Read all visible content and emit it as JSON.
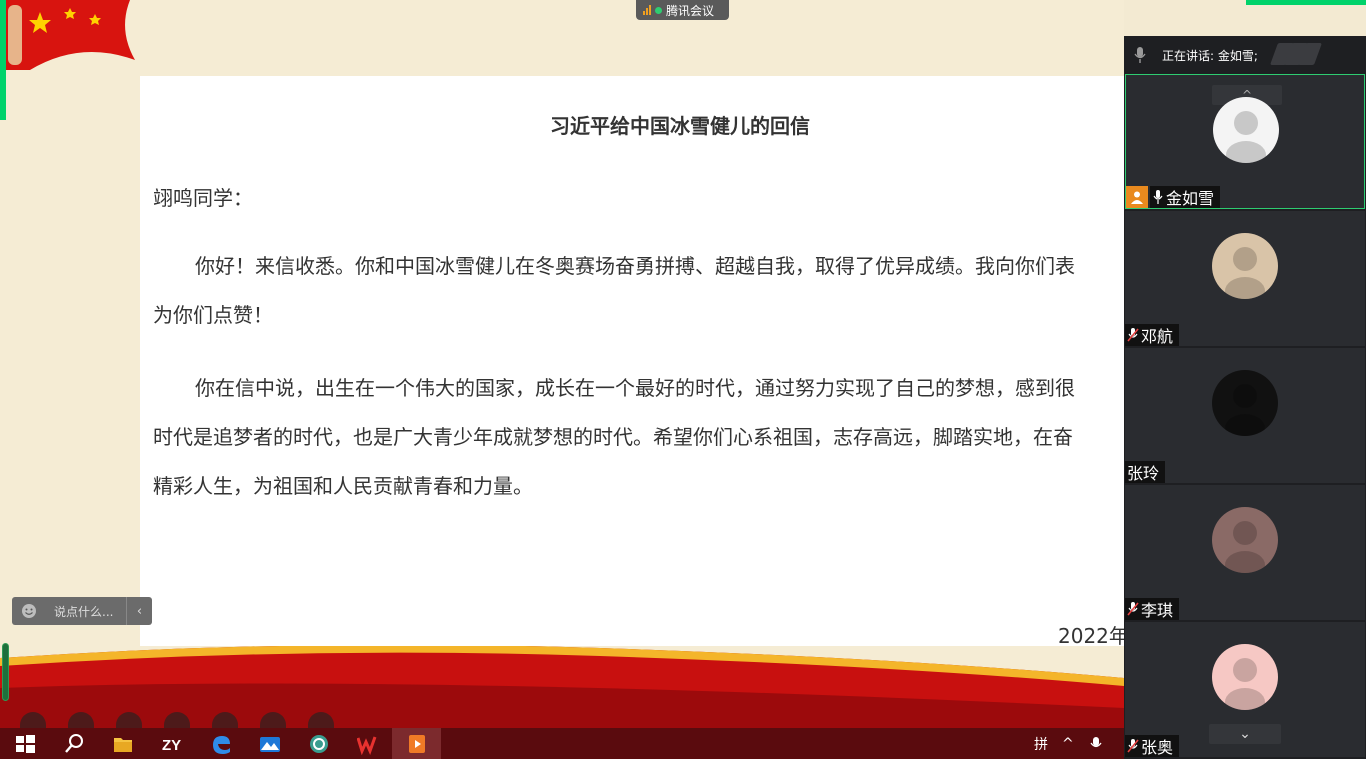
{
  "meeting_tag": {
    "label": "腾讯会议"
  },
  "letter": {
    "title": "习近平给中国冰雪健儿的回信",
    "greeting": "翊鸣同学：",
    "para1_line1": "你好！来信收悉。你和中国冰雪健儿在冬奥赛场奋勇拼搏、超越自我，取得了优异成绩。我向你们表",
    "para1_line2": "为你们点赞！",
    "para2_line1": "你在信中说，出生在一个伟大的国家，成长在一个最好的时代，通过努力实现了自己的梦想，感到很",
    "para2_line2": "时代是追梦者的时代，也是广大青少年成就梦想的时代。希望你们心系祖国，志存高远，脚踏实地，在奋",
    "para2_line3": "精彩人生，为祖国和人民贡献青春和力量。",
    "date": "2022年"
  },
  "chat": {
    "placeholder": "说点什么...",
    "collapse_glyph": "‹"
  },
  "panel": {
    "speaking_label": "正在讲话: 金如雪;",
    "participants": [
      {
        "name": "金如雪",
        "muted": false,
        "host": true,
        "active": true,
        "avatar_color": "#f4f4f4"
      },
      {
        "name": "邓航",
        "muted": true,
        "host": false,
        "active": false,
        "avatar_color": "#d9c4a8"
      },
      {
        "name": "张玲",
        "muted": false,
        "host": false,
        "active": false,
        "avatar_color": "#111111"
      },
      {
        "name": "李琪",
        "muted": true,
        "host": false,
        "active": false,
        "avatar_color": "#8a6a66"
      },
      {
        "name": "张奥",
        "muted": true,
        "host": false,
        "active": false,
        "avatar_color": "#f6c8c4"
      }
    ],
    "scroll_up_glyph": "^",
    "scroll_down_glyph": "⌄"
  },
  "taskbar": {
    "apps": [
      "windows-start",
      "search",
      "file-explorer",
      "zy-app",
      "edge",
      "photos",
      "browser-360",
      "wps-office",
      "powerpoint"
    ],
    "tray_ime": "拼",
    "tray_chevron": "^"
  },
  "colors": {
    "active_green": "#2ecc71",
    "host_orange": "#e98a1e",
    "taskbar_red": "#5a0b0e"
  }
}
